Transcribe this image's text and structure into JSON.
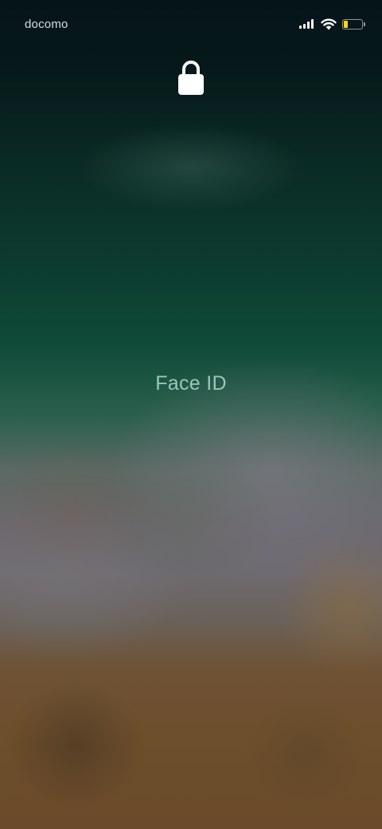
{
  "status_bar": {
    "carrier": "docomo",
    "icons": [
      "cellular-signal-icon",
      "wifi-icon",
      "battery-icon"
    ],
    "battery_level": 0.25,
    "battery_color": "#ffd60a"
  },
  "lock_screen": {
    "lock_icon": "padlock-locked-icon",
    "auth_label": "Face ID"
  }
}
